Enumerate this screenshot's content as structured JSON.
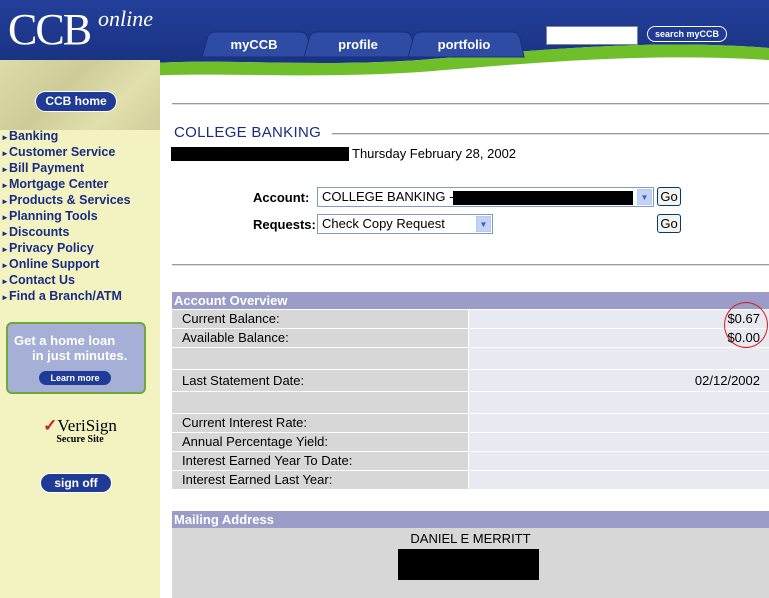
{
  "header": {
    "logo_main": "CCB",
    "logo_sub": "online",
    "tabs": [
      {
        "label": "myCCB"
      },
      {
        "label": "profile"
      },
      {
        "label": "portfolio"
      }
    ],
    "search_button": "search myCCB",
    "search_placeholder": ""
  },
  "sidebar": {
    "home_button": "CCB home",
    "nav": [
      "Banking",
      "Customer Service",
      "Bill Payment",
      "Mortgage Center",
      "Products & Services",
      "Planning Tools",
      "Discounts",
      "Privacy Policy",
      "Online Support",
      "Contact Us",
      "Find a Branch/ATM"
    ],
    "promo": {
      "line1": "Get a home loan",
      "line2": "in just minutes.",
      "button": "Learn more"
    },
    "verisign": {
      "name": "VeriSign",
      "sub": "Secure Site"
    },
    "signoff": "sign off"
  },
  "main": {
    "title": "COLLEGE BANKING",
    "date": "Thursday February 28, 2002",
    "account_label": "Account:",
    "account_value": "COLLEGE BANKING -",
    "requests_label": "Requests:",
    "requests_value": "Check Copy Request",
    "go_label": "Go",
    "overview": {
      "heading": "Account Overview",
      "rows": [
        {
          "label": "Current Balance:",
          "value": "$0.67"
        },
        {
          "label": "Available Balance:",
          "value": "$0.00"
        },
        {
          "label": "",
          "value": ""
        },
        {
          "label": "Last Statement Date:",
          "value": "02/12/2002"
        },
        {
          "label": "",
          "value": ""
        },
        {
          "label": "Current Interest Rate:",
          "value": ""
        },
        {
          "label": "Annual Percentage Yield:",
          "value": ""
        },
        {
          "label": "Interest Earned Year To Date:",
          "value": ""
        },
        {
          "label": "Interest Earned Last Year:",
          "value": ""
        }
      ]
    },
    "mailing": {
      "heading": "Mailing Address",
      "name": "DANIEL E MERRITT"
    }
  },
  "colors": {
    "nav_blue": "#1a2c82",
    "header_blue": "#1f3b96",
    "accent_green": "#6fbf2b",
    "sidebar_bg": "#f3f3c2",
    "section_head": "#9c9cc8",
    "circle_red": "#d31a1a"
  }
}
